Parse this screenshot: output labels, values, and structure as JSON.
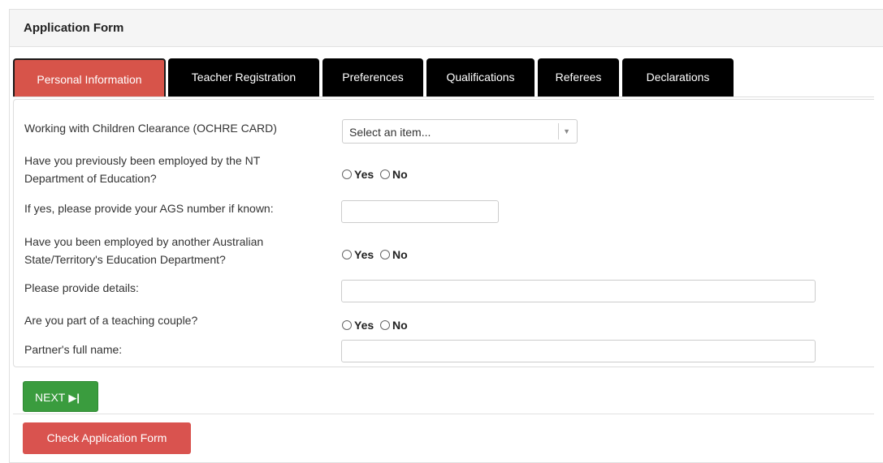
{
  "panel": {
    "title": "Application Form"
  },
  "tabs": [
    {
      "label": "Personal Information",
      "active": true
    },
    {
      "label": "Teacher Registration",
      "active": false
    },
    {
      "label": "Preferences",
      "active": false
    },
    {
      "label": "Qualifications",
      "active": false
    },
    {
      "label": "Referees",
      "active": false
    },
    {
      "label": "Declarations",
      "active": false
    }
  ],
  "form": {
    "ochre": {
      "label": "Working with Children Clearance (OCHRE CARD)",
      "selected": "Select an item..."
    },
    "nt_employed": {
      "label_line1": "Have you previously been employed by the NT",
      "label_line2": "Department of Education?",
      "yes": "Yes",
      "no": "No",
      "value": null
    },
    "ags": {
      "label": "If yes, please provide your AGS number if known:",
      "value": ""
    },
    "other_state": {
      "label_line1": "Have you been employed by another Australian",
      "label_line2": "State/Territory's Education Department?",
      "yes": "Yes",
      "no": "No",
      "value": null
    },
    "details": {
      "label": "Please provide details:",
      "value": ""
    },
    "couple": {
      "label": "Are you part of a teaching couple?",
      "yes": "Yes",
      "no": "No",
      "value": null
    },
    "partner": {
      "label": "Partner's full name:",
      "value": ""
    }
  },
  "buttons": {
    "next": "NEXT",
    "check": "Check Application Form"
  },
  "colors": {
    "active_tab": "#d7544a",
    "tab": "#000000",
    "next_button": "#3a9c3e",
    "check_button": "#d9534f"
  }
}
